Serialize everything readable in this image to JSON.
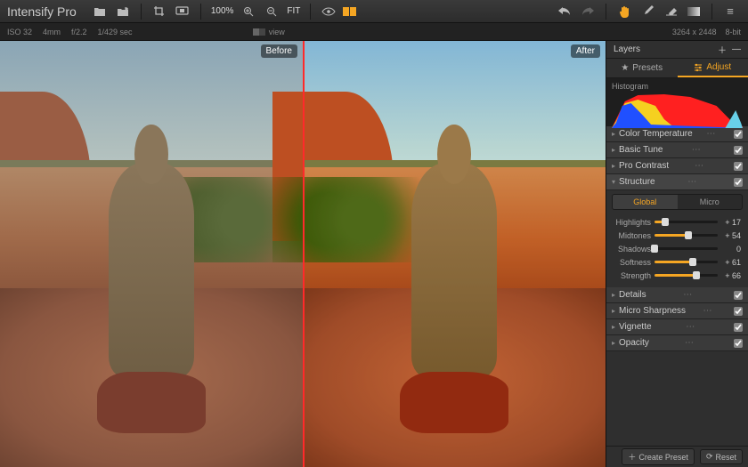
{
  "app": {
    "title": "Intensify Pro"
  },
  "zoom": {
    "percent": "100%",
    "fit": "FIT"
  },
  "exif": {
    "iso": "ISO 32",
    "focal": "4mm",
    "aperture": "f/2.2",
    "shutter": "1/429 sec",
    "view_label": "view",
    "dimensions": "3264 x 2448",
    "bit_depth": "8-bit"
  },
  "compare": {
    "before_label": "Before",
    "after_label": "After"
  },
  "panel": {
    "title": "Layers",
    "tabs": {
      "presets": "Presets",
      "adjust": "Adjust"
    },
    "histogram_label": "Histogram",
    "sections": {
      "color_temp": {
        "label": "Color Temperature",
        "open": false,
        "enabled": true
      },
      "basic_tune": {
        "label": "Basic Tune",
        "open": false,
        "enabled": true
      },
      "pro_contrast": {
        "label": "Pro Contrast",
        "open": false,
        "enabled": true
      },
      "structure": {
        "label": "Structure",
        "open": true,
        "enabled": true
      },
      "details": {
        "label": "Details",
        "open": false,
        "enabled": true
      },
      "micro_sharp": {
        "label": "Micro Sharpness",
        "open": false,
        "enabled": true
      },
      "vignette": {
        "label": "Vignette",
        "open": false,
        "enabled": true
      },
      "opacity": {
        "label": "Opacity",
        "open": false,
        "enabled": true
      }
    },
    "structure": {
      "subtabs": {
        "global": "Global",
        "micro": "Micro"
      },
      "sliders": [
        {
          "label": "Highlights",
          "value": 17,
          "display": "+ 17"
        },
        {
          "label": "Midtones",
          "value": 54,
          "display": "+ 54"
        },
        {
          "label": "Shadows",
          "value": 0,
          "display": "0"
        },
        {
          "label": "Softness",
          "value": 61,
          "display": "+ 61"
        },
        {
          "label": "Strength",
          "value": 66,
          "display": "+ 66"
        }
      ]
    },
    "footer": {
      "create_preset": "Create Preset",
      "reset": "Reset"
    }
  },
  "colors": {
    "accent": "#f5a623",
    "divider": "#ff2a2a"
  }
}
